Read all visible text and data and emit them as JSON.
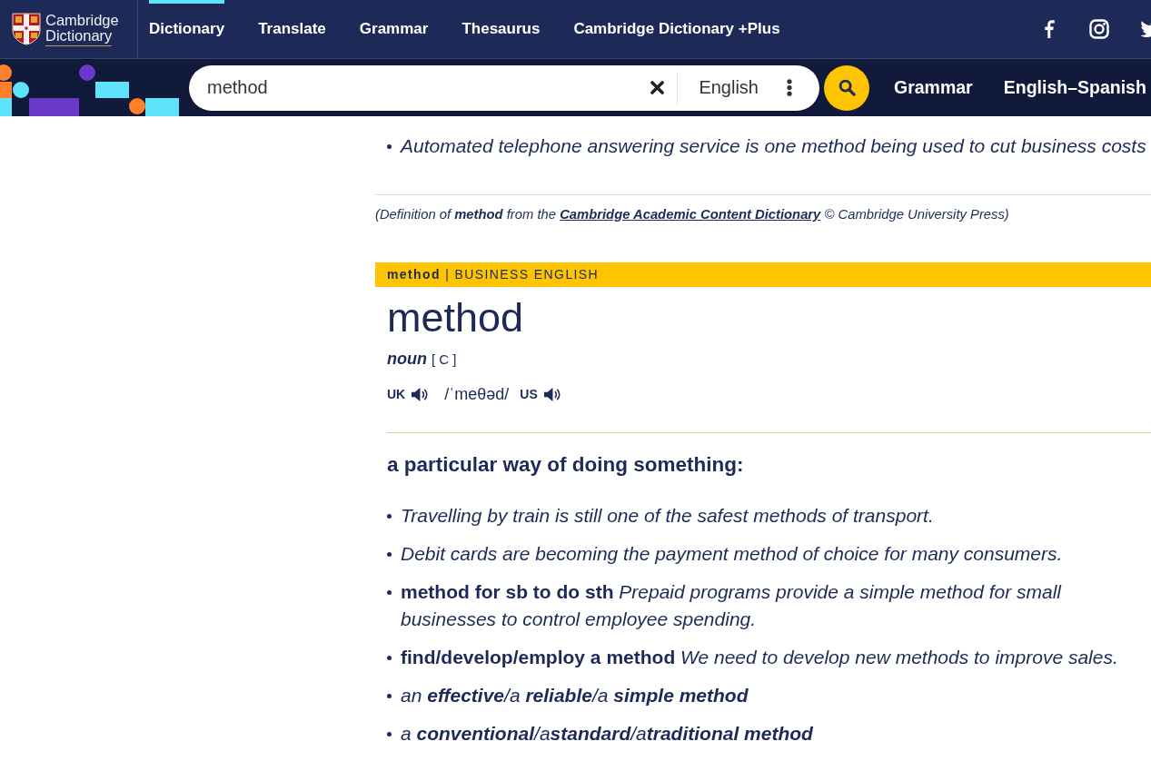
{
  "header": {
    "logo": {
      "line_1": "Cambridge",
      "line_2": "Dictionary"
    },
    "nav": [
      {
        "label": "Dictionary",
        "selected": true
      },
      {
        "label": "Translate",
        "selected": false
      },
      {
        "label": "Grammar",
        "selected": false
      },
      {
        "label": "Thesaurus",
        "selected": false
      },
      {
        "label": "Cambridge Dictionary +Plus",
        "selected": false
      }
    ]
  },
  "search": {
    "value": "method",
    "language": "English"
  },
  "quick_links": [
    "Grammar",
    "English–Spanish"
  ],
  "previous_entry": {
    "examples": [
      {
        "text": "Automated telephone answering service is one method being used to cut business costs"
      }
    ],
    "source": {
      "prefix": "(Definition of **method** from the ",
      "link": "Cambridge Academic Content Dictionary",
      "suffix": " © Cambridge University Press)"
    }
  },
  "entry": {
    "band": "**method** | BUSINESS ENGLISH",
    "headword": "method",
    "part_of_speech": "noun",
    "grammar": "[ C ]",
    "pronunciation": {
      "uk_label": "UK",
      "ipa": "/ˈmeθəd/",
      "us_label": "US"
    },
    "senses": [
      {
        "definition": "a particular way of doing something:",
        "examples": [
          {
            "text": "Travelling by train is still one of the safest methods of transport."
          },
          {
            "text": "Debit cards are becoming the payment method of choice for many consumers."
          },
          {
            "pattern": "method for sb to do sth",
            "text": "Prepaid programs provide a simple method for small businesses to control employee spending."
          },
          {
            "pattern": "find/develop/employ a method",
            "text": "We need to develop new methods to improve sales."
          },
          {
            "text": "an **effective**/a **reliable**/a **simple method**"
          },
          {
            "text": "a **conventional**/a**standard**/a**traditional method**"
          }
        ]
      }
    ]
  }
}
